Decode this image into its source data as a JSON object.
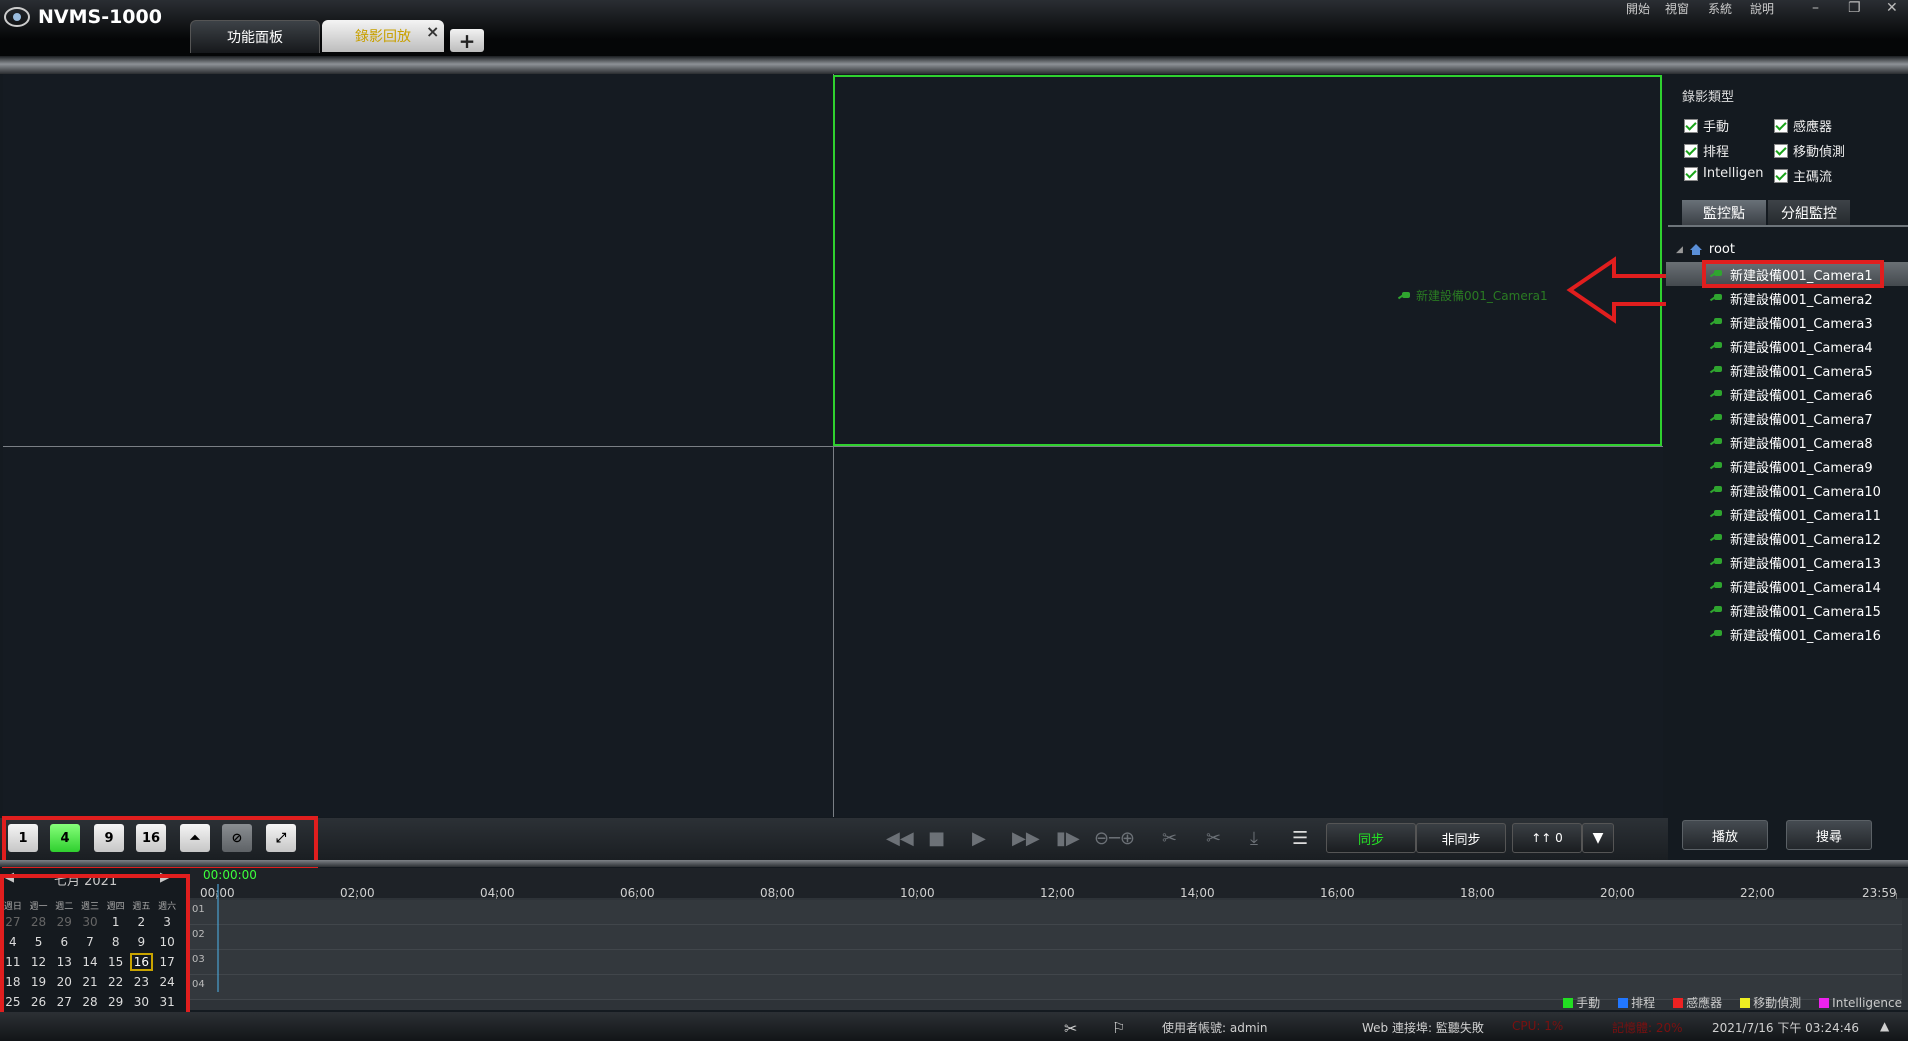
{
  "app": {
    "title": "NVMS-1000"
  },
  "menu": [
    "開始",
    "視窗",
    "系統",
    "說明"
  ],
  "tabs": [
    {
      "label": "功能面板"
    },
    {
      "label": "錄影回放"
    }
  ],
  "tab_close": "×",
  "tab_add": "+",
  "record_type": {
    "title": "錄影類型",
    "options": [
      {
        "label": "手動",
        "checked": true
      },
      {
        "label": "感應器",
        "checked": true
      },
      {
        "label": "排程",
        "checked": true
      },
      {
        "label": "移動偵測",
        "checked": true
      },
      {
        "label": "Intelligen",
        "checked": true
      },
      {
        "label": "主碼流",
        "checked": true
      }
    ]
  },
  "right_tabs": [
    "監控點",
    "分組監控"
  ],
  "tree": {
    "root": "root",
    "cameras": [
      "新建設備001_Camera1",
      "新建設備001_Camera2",
      "新建設備001_Camera3",
      "新建設備001_Camera4",
      "新建設備001_Camera5",
      "新建設備001_Camera6",
      "新建設備001_Camera7",
      "新建設備001_Camera8",
      "新建設備001_Camera9",
      "新建設備001_Camera10",
      "新建設備001_Camera11",
      "新建設備001_Camera12",
      "新建設備001_Camera13",
      "新建設備001_Camera14",
      "新建設備001_Camera15",
      "新建設備001_Camera16"
    ],
    "selected_index": 0
  },
  "video": {
    "overlay_label": "新建設備001_Camera1"
  },
  "right_buttons": {
    "play": "播放",
    "search": "搜尋"
  },
  "split_buttons": [
    "1",
    "4",
    "9",
    "16"
  ],
  "active_split": "4",
  "sync": {
    "sync": "同步",
    "async": "非同步",
    "speed": "↑↑ 0"
  },
  "calendar": {
    "title": "七月  2021",
    "weekdays": [
      "週日",
      "週一",
      "週二",
      "週三",
      "週四",
      "週五",
      "週六"
    ],
    "weeks": [
      [
        "27",
        "28",
        "29",
        "30",
        "1",
        "2",
        "3"
      ],
      [
        "4",
        "5",
        "6",
        "7",
        "8",
        "9",
        "10"
      ],
      [
        "11",
        "12",
        "13",
        "14",
        "15",
        "16",
        "17"
      ],
      [
        "18",
        "19",
        "20",
        "21",
        "22",
        "23",
        "24"
      ],
      [
        "25",
        "26",
        "27",
        "28",
        "29",
        "30",
        "31"
      ]
    ],
    "today": "16"
  },
  "timeline": {
    "current_time": "00:00:00",
    "ticks": [
      "00:00",
      "02:00",
      "04:00",
      "06:00",
      "08:00",
      "10:00",
      "12:00",
      "14:00",
      "16:00",
      "18:00",
      "20:00",
      "22:00",
      "23:59"
    ],
    "rows": [
      "01",
      "02",
      "03",
      "04"
    ]
  },
  "legend": [
    {
      "label": "手動",
      "color": "#22dd22"
    },
    {
      "label": "排程",
      "color": "#2277ff"
    },
    {
      "label": "感應器",
      "color": "#ee2222"
    },
    {
      "label": "移動偵測",
      "color": "#eeee22"
    },
    {
      "label": "Intelligence",
      "color": "#ee22ee"
    }
  ],
  "status": {
    "user": "使用者帳號: admin",
    "web": "Web 連接埠: 監聽失敗",
    "cpu": "CPU: 1%",
    "mem": "記憶體: 20%",
    "datetime": "2021/7/16 下午 03:24:46"
  }
}
